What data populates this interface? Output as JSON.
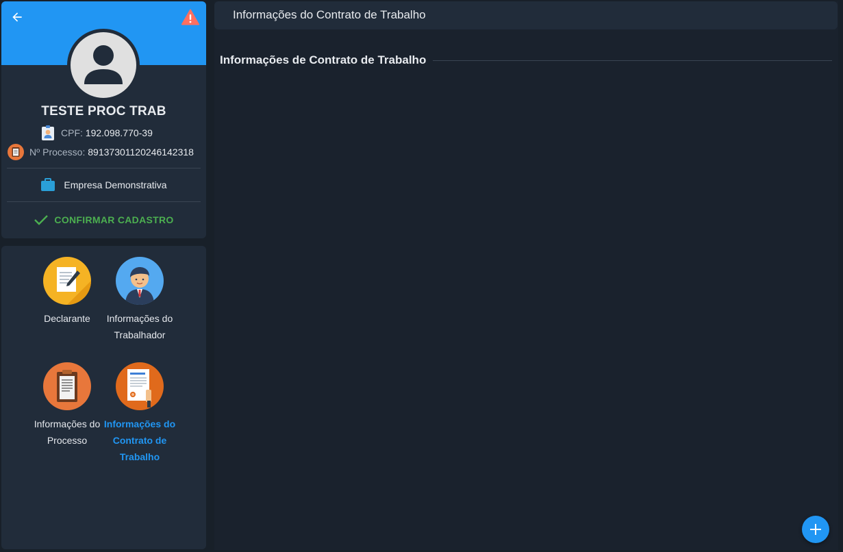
{
  "profile": {
    "name": "TESTE PROC TRAB",
    "cpf_label": "CPF:",
    "cpf_value": "192.098.770-39",
    "process_label": "Nº Processo:",
    "process_value": "89137301120246142318",
    "company": "Empresa Demonstrativa",
    "confirm_label": "CONFIRMAR CADASTRO"
  },
  "nav": {
    "items": [
      {
        "label": "Declarante",
        "icon": "declarante-icon"
      },
      {
        "label": "Informações do Trabalhador",
        "icon": "trabalhador-icon"
      },
      {
        "label": "Informações do Processo",
        "icon": "processo-icon"
      },
      {
        "label": "Informações do Contrato de Trabalho",
        "icon": "contrato-icon",
        "active": true
      }
    ]
  },
  "main": {
    "header_title": "Informações do Contrato de Trabalho",
    "section_title": "Informações de Contrato de Trabalho"
  },
  "colors": {
    "accent": "#2196f3",
    "success": "#4caf50",
    "background": "#182029",
    "card": "#212c3a",
    "warning": "#ff6f60"
  }
}
